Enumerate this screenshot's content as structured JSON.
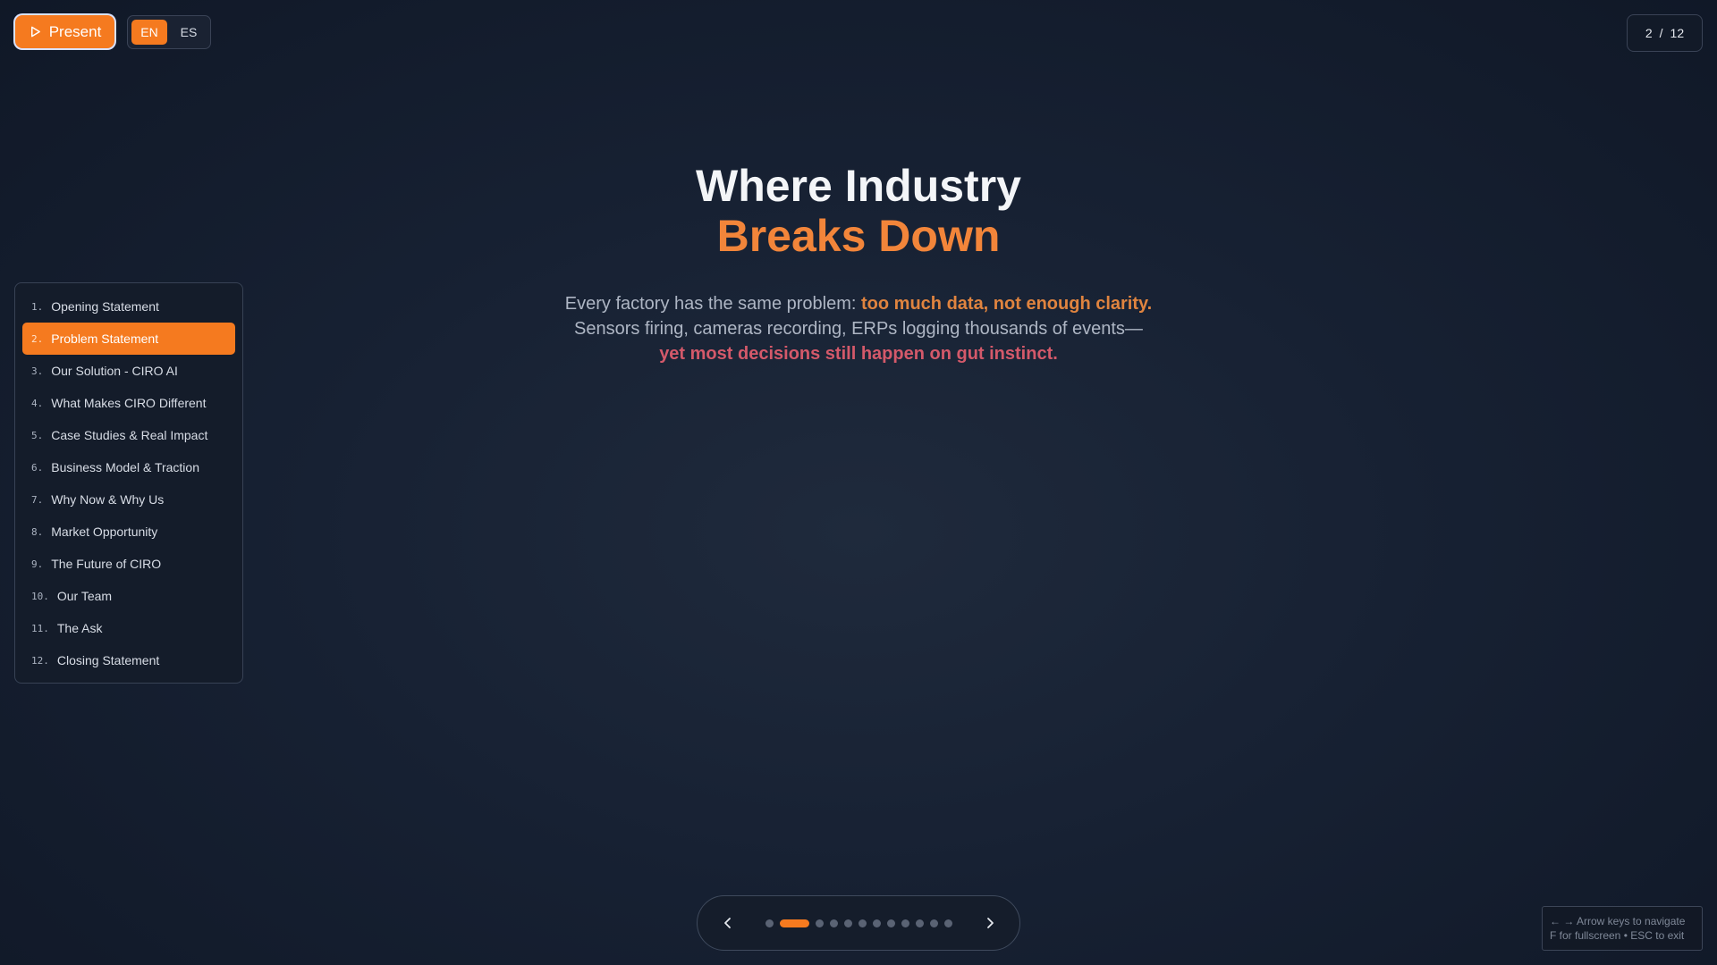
{
  "topbar": {
    "present_label": "Present",
    "languages": [
      "EN",
      "ES"
    ],
    "active_language": "EN"
  },
  "counter": {
    "current": "2",
    "separator": "/",
    "total": "12"
  },
  "toc": {
    "items": [
      {
        "num": "1.",
        "label": "Opening Statement"
      },
      {
        "num": "2.",
        "label": "Problem Statement"
      },
      {
        "num": "3.",
        "label": "Our Solution - CIRO AI"
      },
      {
        "num": "4.",
        "label": "What Makes CIRO Different"
      },
      {
        "num": "5.",
        "label": "Case Studies & Real Impact"
      },
      {
        "num": "6.",
        "label": "Business Model & Traction"
      },
      {
        "num": "7.",
        "label": "Why Now & Why Us"
      },
      {
        "num": "8.",
        "label": "Market Opportunity"
      },
      {
        "num": "9.",
        "label": "The Future of CIRO"
      },
      {
        "num": "10.",
        "label": "Our Team"
      },
      {
        "num": "11.",
        "label": "The Ask"
      },
      {
        "num": "12.",
        "label": "Closing Statement"
      }
    ],
    "active_index": 1
  },
  "slide": {
    "title_line1": "Where Industry",
    "title_line2": "Breaks Down",
    "body_part1": "Every factory has the same problem: ",
    "body_highlight1": "too much data, not enough clarity.",
    "body_part2": "Sensors firing, cameras recording, ERPs logging thousands of events—",
    "body_highlight2": "yet most decisions still happen on gut instinct."
  },
  "nav": {
    "dot_count": 12,
    "active_dot": 1
  },
  "help": {
    "line1": "← → Arrow keys to navigate",
    "line2": "F for fullscreen • ESC to exit"
  },
  "colors": {
    "accent": "#f57a1f",
    "highlight_orange": "#e0843f",
    "highlight_red": "#d4596a",
    "background": "#172133"
  },
  "icons": {
    "present": "play-icon",
    "prev": "chevron-left-icon",
    "next": "chevron-right-icon"
  }
}
